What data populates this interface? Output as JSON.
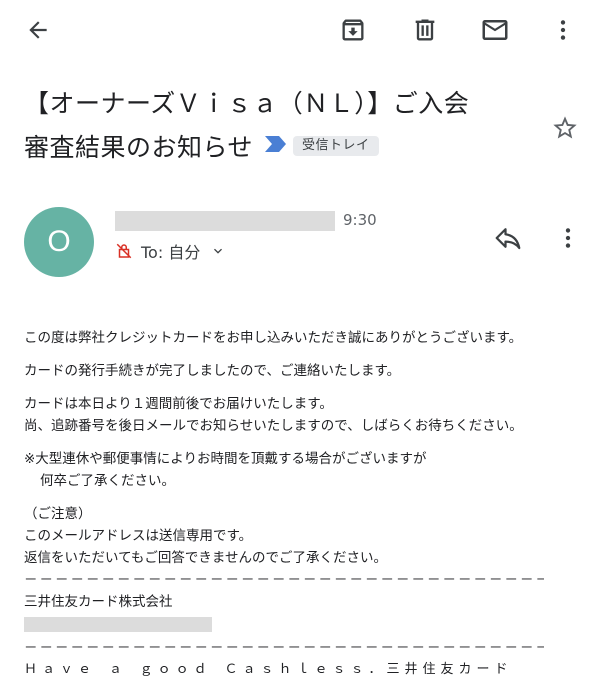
{
  "toolbar": {
    "back_icon": "arrow-back-icon",
    "archive_icon": "archive-icon",
    "delete_icon": "trash-icon",
    "mark_unread_icon": "envelope-icon",
    "more_icon": "more-vert-icon"
  },
  "subject": {
    "line1": "【オーナーズＶｉｓａ（ＮＬ）】ご入会",
    "line2": "審査結果のお知らせ",
    "label": "受信トレイ",
    "important_color": "#4a7fd4"
  },
  "sender": {
    "avatar_letter": "O",
    "avatar_color": "#66b3a4",
    "time": "9:30",
    "to_label": "To: 自分"
  },
  "body": {
    "p1": "この度は弊社クレジットカードをお申し込みいただき誠にありがとうございます。",
    "p2": "カードの発行手続きが完了しましたので、ご連絡いたします。",
    "p3a": "カードは本日より１週間前後でお届けいたします。",
    "p3b": "尚、追跡番号を後日メールでお知らせいたしますので、しばらくお待ちください。",
    "p4a": "※大型連休や郵便事情によりお時間を頂戴する場合がございますが",
    "p4b": "何卒ご了承ください。",
    "p5a": "（ご注意）",
    "p5b": "このメールアドレスは送信専用です。",
    "p5c": "返信をいただいてもご回答できませんのでご了承ください。",
    "separator": "－－－－－－－－－－－－－－－－－－－－－－－－－－－－－－－－－－－－",
    "company": "三井住友カード株式会社",
    "separator2": "－－－－－－－－－－－－－－－－－－－－－－－－－－－－－－－－－－－－",
    "footer": "Ｈａｖｅ ａ ｇｏｏｄ Ｃａｓｈｌｅｓｓ．三井住友カード"
  }
}
